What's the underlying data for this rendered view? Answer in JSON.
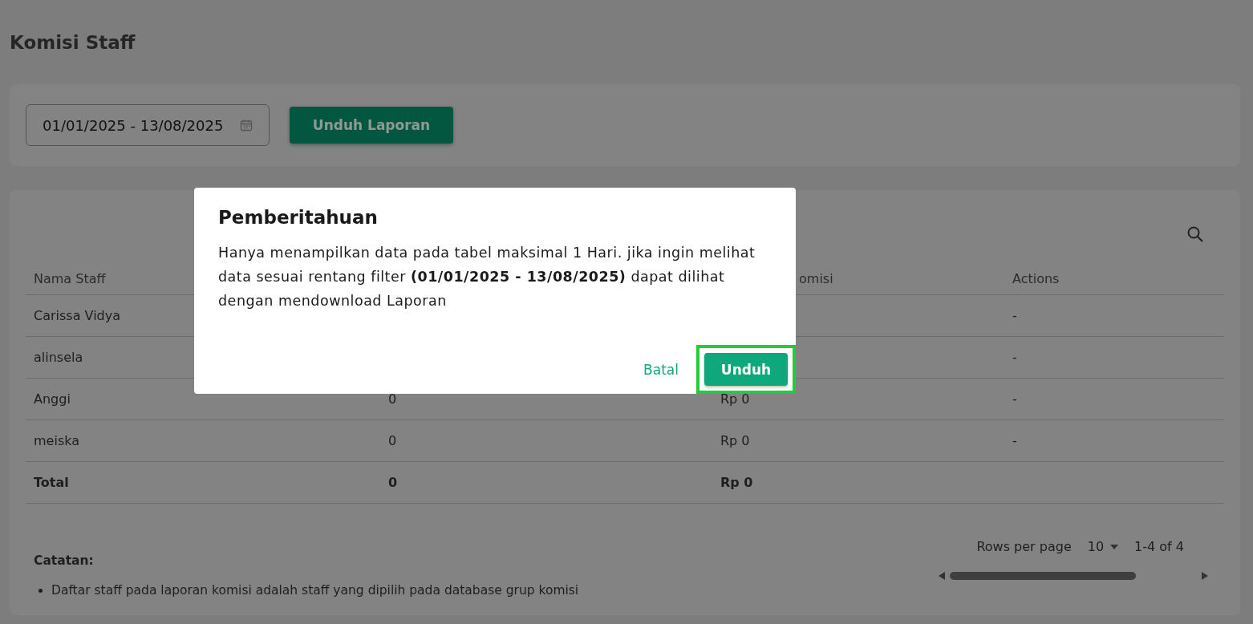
{
  "page_title": "Komisi Staff",
  "filter": {
    "date_range": "01/01/2025 - 13/08/2025",
    "download_button": "Unduh Laporan"
  },
  "table": {
    "columns": [
      "Nama Staff",
      "",
      "omisi",
      "Actions"
    ],
    "rows": [
      {
        "cells": [
          "Carissa Vidya",
          "",
          "",
          "-"
        ]
      },
      {
        "cells": [
          "alinsela",
          "",
          "",
          "-"
        ]
      },
      {
        "cells": [
          "Anggi",
          "0",
          "Rp 0",
          "-"
        ]
      },
      {
        "cells": [
          "meiska",
          "0",
          "Rp 0",
          "-"
        ]
      }
    ],
    "total": [
      "Total",
      "0",
      "Rp 0"
    ]
  },
  "notes": {
    "title": "Catatan:",
    "items": [
      "Daftar staff pada laporan komisi adalah staff yang dipilih pada database grup komisi"
    ]
  },
  "pagination": {
    "rows_per_page_label": "Rows per page",
    "rows_per_page": "10",
    "range": "1-4 of 4"
  },
  "dialog": {
    "title": "Pemberitahuan",
    "message": "Hanya menampilkan data pada tabel maksimal 1 Hari. jika ingin melihat data sesuai rentang filter **(01/01/2025 - 13/08/2025)** dapat dilihat dengan mendownload Laporan",
    "buttons": [
      {
        "label": "Batal",
        "kind": "text",
        "highlighted": false
      },
      {
        "label": "Unduh",
        "kind": "primary",
        "highlighted": true
      }
    ]
  }
}
